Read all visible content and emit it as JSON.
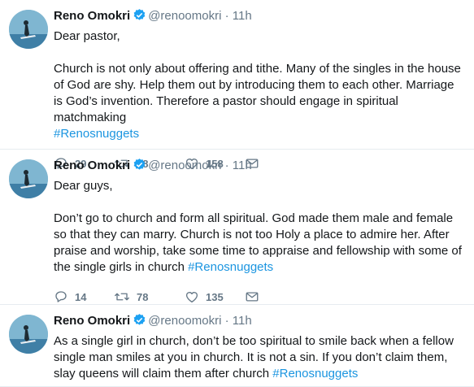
{
  "tweets": [
    {
      "name": "Reno Omokri",
      "handle": "@renoomokri",
      "dot": "·",
      "time": "11h",
      "paragraphs": [
        "Dear pastor,",
        "Church is not only about offering and tithe. Many of the singles in the house of God are shy. Help them out by introducing them to each other. Marriage is God’s invention. Therefore a pastor should engage in spiritual matchmaking"
      ],
      "hashtag": "#Renosnuggets",
      "replies": "29",
      "retweets": "78",
      "likes": "158"
    },
    {
      "name": "Reno Omokri",
      "handle": "@renoomokri",
      "dot": "·",
      "time": "11h",
      "paragraphs": [
        "Dear guys,",
        "Don’t go to church and form all spiritual. God made them male and female so that they can marry. Church is not too Holy a place to admire her. After praise and worship, take some time to appraise and fellowship with some of the single girls in church"
      ],
      "hashtag": "#Renosnuggets",
      "replies": "14",
      "retweets": "78",
      "likes": "135"
    },
    {
      "name": "Reno Omokri",
      "handle": "@renoomokri",
      "dot": "·",
      "time": "11h",
      "paragraphs": [
        "As a single girl in church, don’t be too spiritual to smile back when a fellow single man smiles at you in church. It is not a sin. If you don’t claim them, slay queens will claim them after church"
      ],
      "hashtag": "#Renosnuggets"
    }
  ],
  "colors": {
    "text": "#14171a",
    "secondary": "#657786",
    "link": "#1b95e0",
    "verified": "#1da1f2",
    "divider": "#e6ecf0"
  },
  "icons": [
    "reply-icon",
    "retweet-icon",
    "like-icon",
    "message-icon",
    "verified-badge-icon"
  ]
}
